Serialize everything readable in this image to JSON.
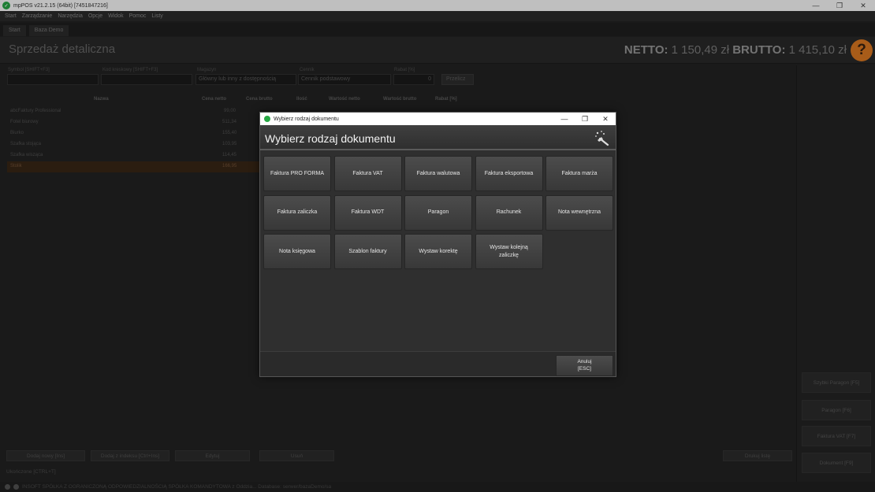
{
  "window": {
    "title": "mpPOS v21.2.15 (64bit) [7451847216]",
    "minimize": "—",
    "maximize": "❐",
    "close": "✕"
  },
  "menu": [
    "Start",
    "Zarządzanie",
    "Narzędzia",
    "Opcje",
    "Widok",
    "Pomoc",
    "Listy"
  ],
  "tabs": [
    "Start",
    "Baza Demo"
  ],
  "header": {
    "title": "Sprzedaż detaliczna",
    "netto_label": "NETTO:",
    "netto_value": "1 150,49 zł",
    "brutto_label": "BRUTTO:",
    "brutto_value": "1 415,10 zł",
    "help": "?"
  },
  "filters": {
    "symbol_label": "Symbol [SHIFT+F3]",
    "symbol_value": "",
    "kod_label": "Kod kreskowy [SHIFT+F3]",
    "kod_value": "",
    "magazyn_label": "Magazyn",
    "magazyn_value": "Główny lub inny z dostępnością",
    "cennik_label": "Cennik",
    "cennik_value": "Cennik podstawowy",
    "rabat_label": "Rabat [%]",
    "rabat_value": "0",
    "przelicz": "Przelicz"
  },
  "table": {
    "columns": [
      "Nazwa",
      "Cena netto",
      "Cena brutto",
      "Ilość",
      "Wartość netto",
      "Wartość brutto",
      "Rabat [%]"
    ],
    "rows": [
      {
        "name": "abcFaktury Professional",
        "netto": "99,00"
      },
      {
        "name": "Fotel biurowy",
        "netto": "511,34"
      },
      {
        "name": "Biurko",
        "netto": "155,40"
      },
      {
        "name": "Szafka stojąca",
        "netto": "103,95"
      },
      {
        "name": "Szafka wisząca",
        "netto": "114,45"
      },
      {
        "name": "Stolik",
        "netto": "166,95"
      }
    ]
  },
  "right_panel": [
    "Szybki Paragon [F5]",
    "Paragon [F6]",
    "Faktura VAT [F7]",
    "Dokument [F9]"
  ],
  "bottom_buttons": [
    "Dodaj nowy [Ins]",
    "Dodaj z indeksu [Ctrl+Ins]",
    "Edytuj",
    "Usuń",
    "Drukuj listę"
  ],
  "hidden_label": "Ukończone [CTRL+T]",
  "status": "INSOFT SPÓŁKA Z OGRANICZONĄ ODPOWIEDZIALNOŚCIĄ SPÓŁKA KOMANDYTOWA z Oddzia... Database: serwer/bazaDemo/sa",
  "dialog": {
    "window_title": "Wybierz rodzaj dokumentu",
    "heading": "Wybierz rodzaj dokumentu",
    "buttons": [
      "Faktura PRO FORMA",
      "Faktura VAT",
      "Faktura walutowa",
      "Faktura eksportowa",
      "Faktura marża",
      "Faktura zaliczka",
      "Faktura WDT",
      "Paragon",
      "Rachunek",
      "Nota wewnętrzna",
      "Nota księgowa",
      "Szablon faktury",
      "Wystaw korektę",
      "Wystaw kolejną zaliczkę"
    ],
    "cancel_line1": "Anuluj",
    "cancel_line2": "[ESC]"
  },
  "colors": {
    "accent": "#e07b22",
    "logo": "#27a844",
    "background": "#232323"
  }
}
